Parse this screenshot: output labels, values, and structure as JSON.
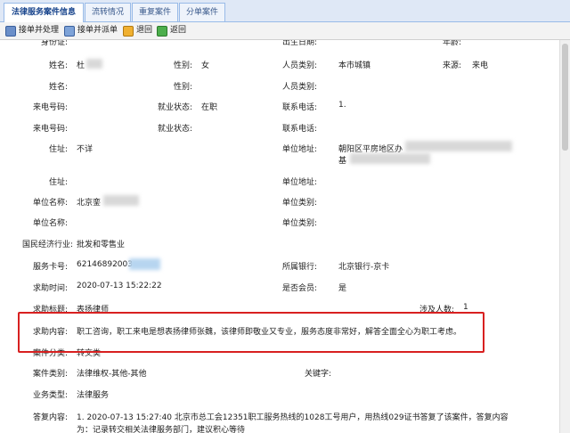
{
  "tabs": [
    {
      "label": "法律服务案件信息",
      "active": true
    },
    {
      "label": "流转情况",
      "active": false
    },
    {
      "label": "重复案件",
      "active": false
    },
    {
      "label": "分单案件",
      "active": false
    }
  ],
  "toolbar": {
    "btn1": "接单并处理",
    "btn2": "接单并派单",
    "btn3": "退回",
    "btn4": "返回"
  },
  "form": {
    "r0": {
      "l1": "身份证:",
      "l2": "出生日期:",
      "l3": "年龄:"
    },
    "r1": {
      "l1": "姓名:",
      "v1": "杜",
      "l2": "性别:",
      "v2": "女",
      "l3": "人员类别:",
      "v3": "本市城镇",
      "l4": "来源:",
      "v4": "来电"
    },
    "r2": {
      "l1": "姓名:",
      "l2": "性别:",
      "l3": "人员类别:"
    },
    "r3": {
      "l1": "来电号码:",
      "l2": "就业状态:",
      "v2": "在职",
      "l3": "联系电话:",
      "v3": "1."
    },
    "r4": {
      "l1": "来电号码:",
      "l2": "就业状态:",
      "l3": "联系电话:"
    },
    "r5": {
      "l1": "住址:",
      "v1": "不详",
      "l3": "单位地址:",
      "v3a": "朝阳区平房地区办",
      "v3b": "基"
    },
    "r6": {
      "l1": "住址:",
      "l3": "单位地址:"
    },
    "r7": {
      "l1": "单位名称:",
      "v1": "北京銮",
      "l3": "单位类别:"
    },
    "r8": {
      "l1": "单位名称:",
      "l3": "单位类别:"
    },
    "r9": {
      "l1": "国民经济行业:",
      "v1": "批发和零售业"
    },
    "r10": {
      "l1": "服务卡号:",
      "v1": "62146892003",
      "l3": "所属银行:",
      "v3": "北京银行-京卡"
    },
    "r11": {
      "l1": "求助时间:",
      "v1": "2020-07-13 15:22:22",
      "l3": "是否会员:",
      "v3": "是"
    },
    "r12": {
      "l1": "求助标题:",
      "v1": "表扬律师",
      "l4": "涉及人数:",
      "v4": "1"
    },
    "r13": {
      "l1": "求助内容:",
      "v1": "职工咨询，职工来电是想表扬律师张魏，该律师即敬业又专业，服务态度非常好，解答全面全心为职工考虑。"
    },
    "r14": {
      "l1": "案件分类:",
      "v1": "转交类"
    },
    "r15": {
      "l1": "案件类别:",
      "v1": "法律维权-其他-其他",
      "l3": "关键字:"
    },
    "r16": {
      "l1": "业务类型:",
      "v1": "法律服务"
    },
    "r17": {
      "l1": "答复内容:",
      "v1a": "1. 2020-07-13 15:27:40  北京市总工会12351职工服务热线的1028工号用户，用热线029证书答复了该案件，答复内容",
      "v1b": "为：记录转交相关法律服务部门，建议积心等待"
    }
  },
  "colors": {
    "accent": "#15428b",
    "highlight_box": "#d82020",
    "tabbar_bg": "#dfe8f6"
  }
}
